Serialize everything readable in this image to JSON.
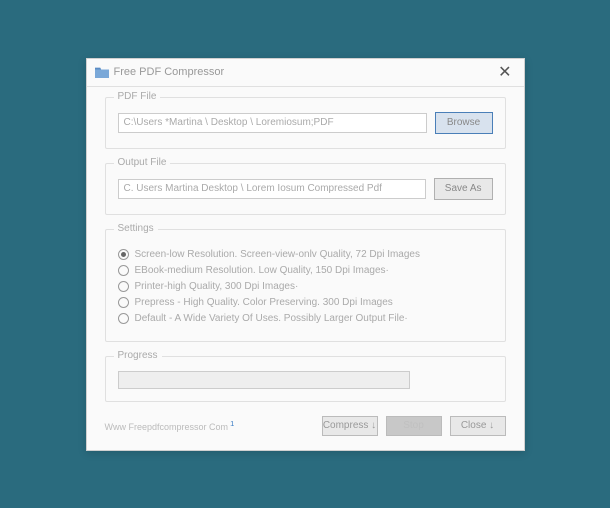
{
  "title": "Free PDF Compressor",
  "pdf_file": {
    "label": "PDF File",
    "value": "C:\\Users *Martina \\ Desktop \\ Loremiosum;PDF",
    "browse": "Browse"
  },
  "output_file": {
    "label": "Output File",
    "value": "C. Users Martina Desktop \\ Lorem Iosum Compressed Pdf",
    "save_as": "Save As"
  },
  "settings": {
    "label": "Settings",
    "options": [
      "Screen-low Resolution. Screen-view-onlv Quality, 72 Dpi Images",
      "EBook-medium Resolution. Low Quality, 150 Dpi Images·",
      "Printer-high Quality, 300 Dpi Images·",
      "Prepress - High Quality. Color Preserving. 300 Dpi Images",
      "Default - A Wide Variety Of Uses. Possibly Larger Output File·"
    ],
    "selected": 0
  },
  "progress": {
    "label": "Progress"
  },
  "footer": {
    "link": "Www Freepdfcompressor Com",
    "compress": "Compress ↓",
    "stop": "Stop",
    "close": "Close ↓"
  }
}
